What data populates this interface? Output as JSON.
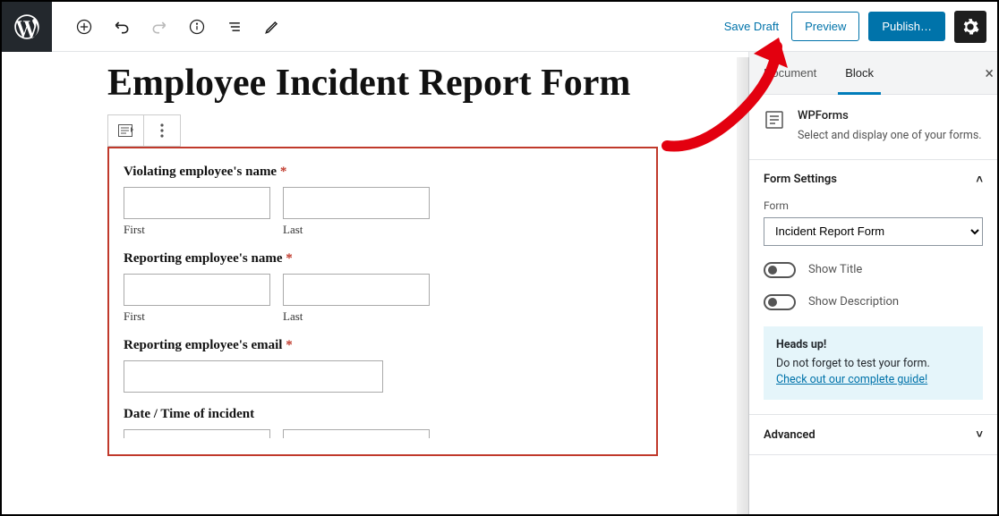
{
  "toolbar": {
    "save_draft": "Save Draft",
    "preview": "Preview",
    "publish": "Publish…"
  },
  "page": {
    "title": "Employee Incident Report Form"
  },
  "form": {
    "field1_label": "Violating employee's name ",
    "field2_label": "Reporting employee's name ",
    "field3_label": "Reporting employee's email ",
    "field4_label": "Date / Time of incident",
    "first": "First",
    "last": "Last",
    "required": "*"
  },
  "sidebar": {
    "tab_document": "Document",
    "tab_block": "Block",
    "block_title": "WPForms",
    "block_desc": "Select and display one of your forms.",
    "panel_form_settings": "Form Settings",
    "form_label": "Form",
    "form_selected": "Incident Report Form",
    "toggle_title": "Show Title",
    "toggle_desc": "Show Description",
    "notice_head": "Heads up!",
    "notice_body": "Do not forget to test your form.",
    "notice_link": "Check out our complete guide!",
    "panel_advanced": "Advanced"
  }
}
